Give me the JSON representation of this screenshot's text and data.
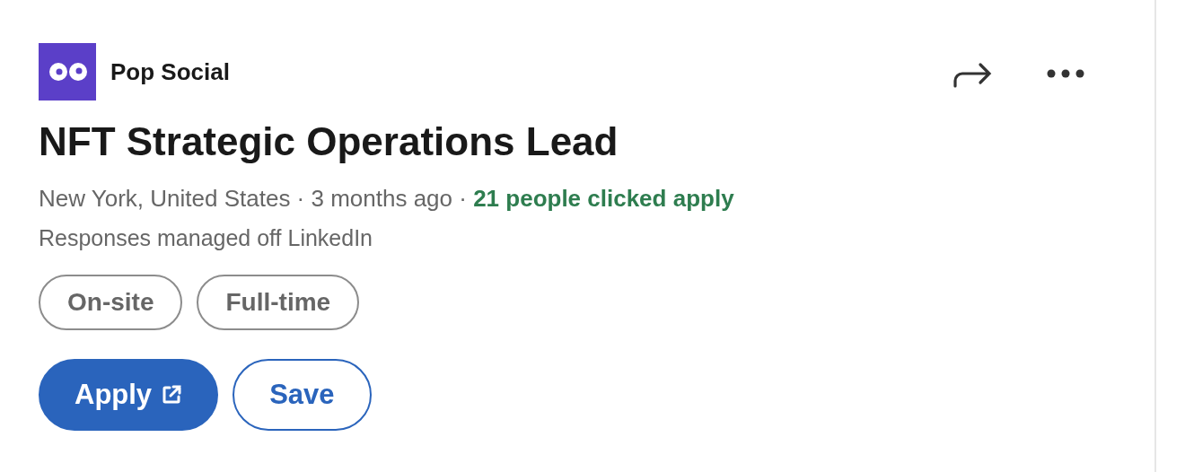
{
  "company": {
    "name": "Pop Social"
  },
  "job": {
    "title": "NFT Strategic Operations Lead",
    "meta": "New York, United States · 3 months ago · **21 people clicked apply**",
    "note": "Responses managed off LinkedIn",
    "tags": [
      "On-site",
      "Full-time"
    ]
  },
  "actions": [
    {
      "kind": "primary",
      "label": "Apply",
      "external": true
    },
    {
      "kind": "secondary",
      "label": "Save",
      "external": false
    }
  ]
}
